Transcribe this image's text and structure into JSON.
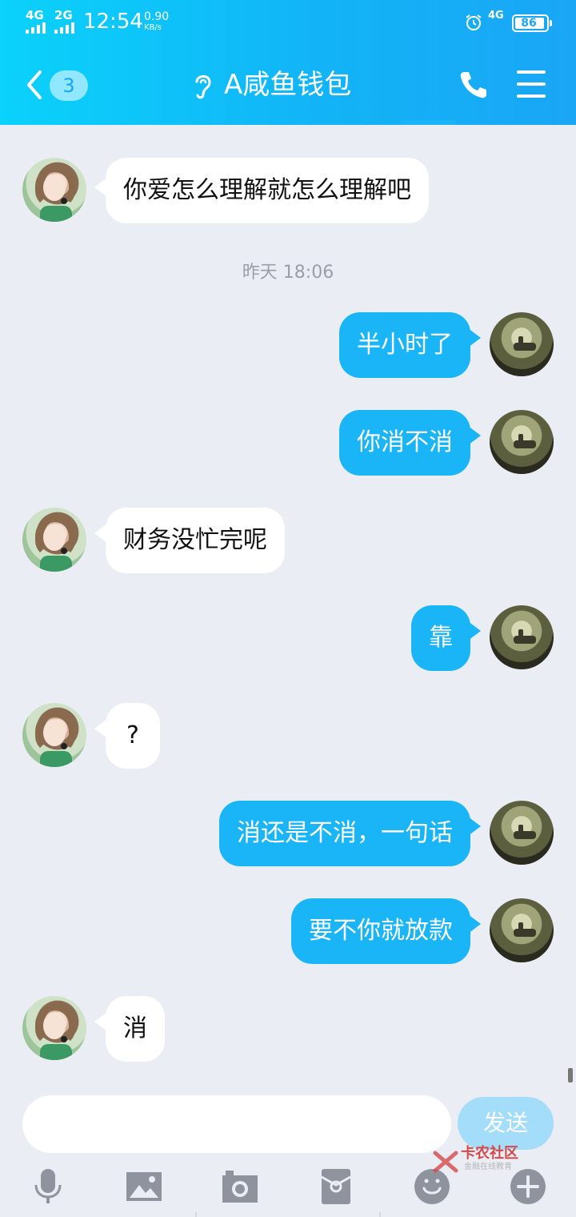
{
  "status_bar": {
    "signal_1": "4G",
    "signal_2": "2G",
    "time": "12:54",
    "speed": "0.90",
    "speed_unit": "KB/s",
    "network": "4G",
    "battery": "86"
  },
  "header": {
    "back_count": "3",
    "title": "A咸鱼钱包",
    "icons": [
      "back-chevron-icon",
      "ear-icon",
      "phone-icon",
      "menu-icon"
    ]
  },
  "messages": [
    {
      "side": "in",
      "text": "你爱怎么理解就怎么理解吧"
    },
    {
      "timestamp": "昨天 18:06"
    },
    {
      "side": "out",
      "text": "半小时了"
    },
    {
      "side": "out",
      "text": "你消不消"
    },
    {
      "side": "in",
      "text": "财务没忙完呢"
    },
    {
      "side": "out",
      "text": "靠"
    },
    {
      "side": "in",
      "text": "?"
    },
    {
      "side": "out",
      "text": "消还是不消，一句话"
    },
    {
      "side": "out",
      "text": "要不你就放款"
    },
    {
      "side": "in",
      "text": "消"
    }
  ],
  "input": {
    "value": "",
    "send_label": "发送"
  },
  "toolbar": {
    "icons": [
      "microphone-icon",
      "image-icon",
      "camera-icon",
      "red-packet-icon",
      "emoji-icon",
      "plus-icon"
    ]
  },
  "watermark": {
    "title": "卡农社区",
    "subtitle": "金融在线教育"
  },
  "colors": {
    "header_start": "#0ad2fb",
    "header_end": "#1aa6f5",
    "outgoing_bubble": "#1ab5f7",
    "incoming_bubble": "#ffffff",
    "background": "#ebedf5"
  }
}
